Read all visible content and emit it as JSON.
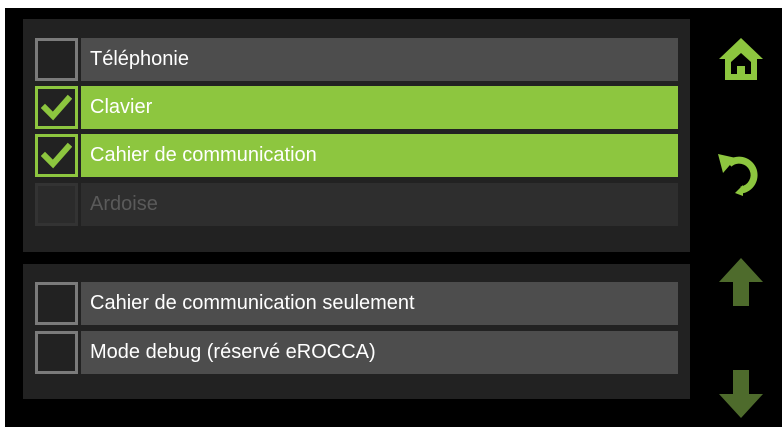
{
  "colors": {
    "accent": "#8dc63f",
    "accent_dim": "#4e6b2c",
    "background": "#000000",
    "panel": "#222222",
    "row": "#4d4d4d",
    "row_disabled": "#2e2e2e"
  },
  "apps_panel": {
    "items": [
      {
        "label": "Téléphonie",
        "checked": false,
        "enabled": true
      },
      {
        "label": "Clavier",
        "checked": true,
        "enabled": true
      },
      {
        "label": "Cahier de communication",
        "checked": true,
        "enabled": true
      },
      {
        "label": "Ardoise",
        "checked": false,
        "enabled": false
      }
    ]
  },
  "options_panel": {
    "items": [
      {
        "label": "Cahier de communication seulement",
        "checked": false,
        "enabled": true
      },
      {
        "label": "Mode debug (réservé eROCCA)",
        "checked": false,
        "enabled": true
      }
    ]
  },
  "side_nav": {
    "home": {
      "icon": "home-icon",
      "enabled": true
    },
    "back": {
      "icon": "undo-icon",
      "enabled": true
    },
    "up": {
      "icon": "arrow-up-icon",
      "enabled": false
    },
    "down": {
      "icon": "arrow-down-icon",
      "enabled": false
    }
  }
}
